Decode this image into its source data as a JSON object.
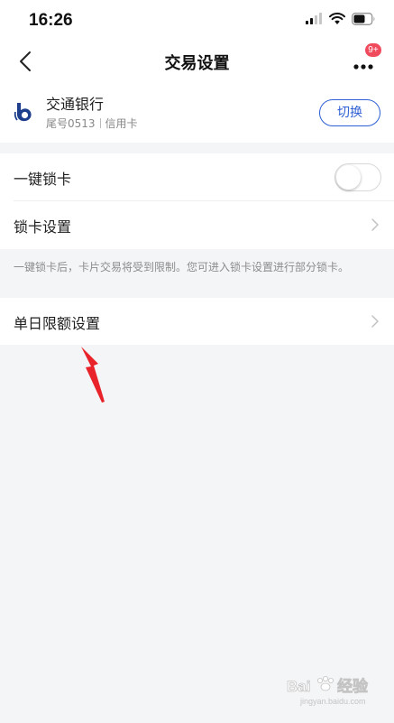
{
  "status_bar": {
    "time": "16:26",
    "icons": [
      "signal-icon",
      "wifi-icon",
      "battery-icon"
    ]
  },
  "nav": {
    "title": "交易设置",
    "back_icon": "chevron-left-icon",
    "more_icon": "more-dots-icon",
    "more_badge": "9+"
  },
  "card": {
    "bank_name": "交通银行",
    "tail": "尾号0513",
    "type": "信用卡",
    "switch_label": "切换",
    "logo_icon": "bocom-logo-icon"
  },
  "settings": {
    "one_key_lock_label": "一键锁卡",
    "one_key_lock_enabled": false,
    "lock_settings_label": "锁卡设置"
  },
  "hint": "一键锁卡后，卡片交易将受到限制。您可进入锁卡设置进行部分锁卡。",
  "limit": {
    "label": "单日限额设置"
  },
  "colors": {
    "accent": "#2e5fd4",
    "badge": "#f04a5d",
    "annotation_arrow": "#e8232a",
    "background": "#f4f5f7"
  },
  "watermark": {
    "text": "Bai",
    "text2": "经验",
    "sub": "jingyan.baidu.com"
  }
}
